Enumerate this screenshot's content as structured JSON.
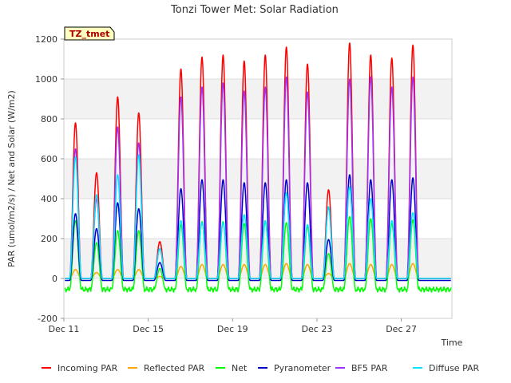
{
  "chart_data": {
    "type": "line",
    "title": "Tonzi Tower Met: Solar Radiation",
    "xlabel": "Time",
    "ylabel": "PAR (umol/m2/s) / Net and Solar (W/m2)",
    "ylim": [
      -200,
      1200
    ],
    "yticks": [
      -200,
      0,
      200,
      400,
      600,
      800,
      1000,
      1200
    ],
    "xlim": [
      11.0,
      29.4
    ],
    "xticks": [
      {
        "value": 11,
        "label": "Dec 11"
      },
      {
        "value": 15,
        "label": "Dec 15"
      },
      {
        "value": 19,
        "label": "Dec 19"
      },
      {
        "value": 23,
        "label": "Dec 23"
      },
      {
        "value": 27,
        "label": "Dec 27"
      }
    ],
    "background_bands": "alternating light gray horizontal bands",
    "annotation": "TZ_tmet",
    "legend_position": "bottom",
    "days": [
      11.55,
      12.55,
      13.55,
      14.55,
      15.55,
      16.55,
      17.55,
      18.55,
      19.55,
      20.55,
      21.55,
      22.55,
      23.55,
      24.55,
      25.55,
      26.55,
      27.55,
      28.55
    ],
    "series": [
      {
        "name": "Incoming PAR",
        "color": "#ff0000",
        "peaks": [
          780,
          530,
          910,
          830,
          185,
          1050,
          1110,
          1120,
          1090,
          1120,
          1160,
          1075,
          445,
          1180,
          1120,
          1105,
          1170,
          0
        ],
        "baseline": 0
      },
      {
        "name": "Reflected PAR",
        "color": "#ffa500",
        "peaks": [
          45,
          30,
          45,
          45,
          10,
          60,
          70,
          70,
          70,
          70,
          75,
          70,
          25,
          75,
          70,
          70,
          75,
          0
        ],
        "baseline": 0
      },
      {
        "name": "Net",
        "color": "#00ff00",
        "peaks": [
          290,
          180,
          240,
          240,
          50,
          270,
          285,
          285,
          275,
          285,
          280,
          260,
          125,
          310,
          300,
          275,
          295,
          0
        ],
        "baseline": -55
      },
      {
        "name": "Pyranometer",
        "color": "#0000cc",
        "peaks": [
          325,
          250,
          380,
          350,
          80,
          450,
          495,
          495,
          480,
          480,
          495,
          480,
          195,
          520,
          495,
          495,
          505,
          0
        ],
        "baseline": -10
      },
      {
        "name": "BF5 PAR",
        "color": "#9933ff",
        "peaks": [
          650,
          400,
          760,
          680,
          150,
          910,
          960,
          980,
          940,
          960,
          1010,
          935,
          360,
          1000,
          1010,
          960,
          1010,
          0
        ],
        "baseline": 0
      },
      {
        "name": "Diffuse PAR",
        "color": "#00e5ff",
        "peaks": [
          610,
          420,
          520,
          620,
          150,
          290,
          280,
          280,
          320,
          290,
          430,
          270,
          360,
          460,
          400,
          290,
          330,
          0
        ],
        "baseline": 0
      }
    ]
  }
}
